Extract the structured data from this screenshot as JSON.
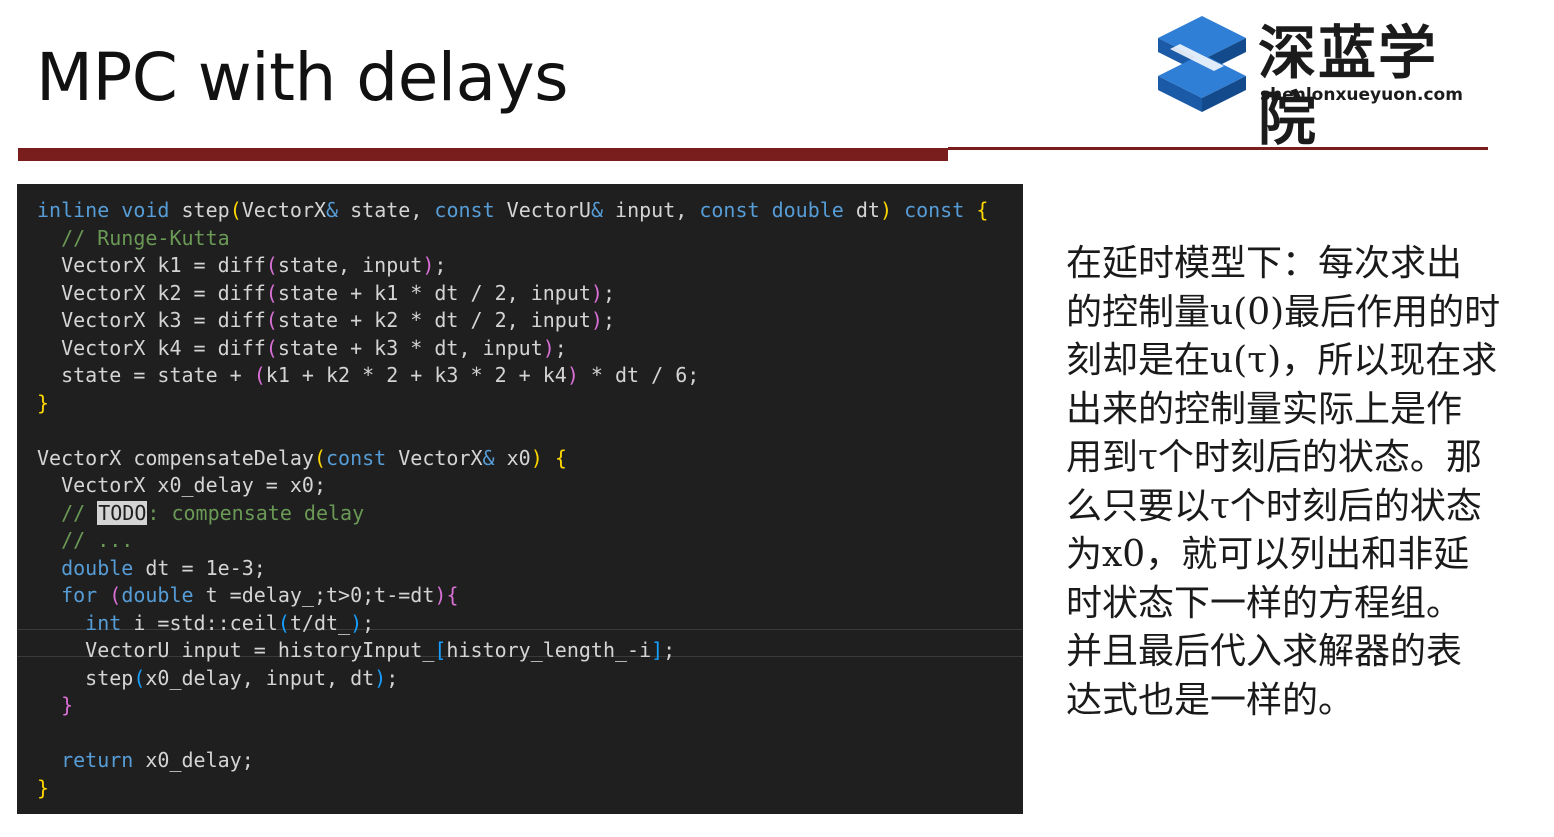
{
  "slide": {
    "title": "MPC with delays",
    "logo": {
      "name_cn": "深蓝学院",
      "url": "shenlonxueyuon.com",
      "color": "#1f6bc2"
    },
    "accent_color": "#7a1d1d"
  },
  "code_lines": [
    "inline void step(VectorX& state, const VectorU& input, const double dt) const {",
    "  // Runge-Kutta",
    "  VectorX k1 = diff(state, input);",
    "  VectorX k2 = diff(state + k1 * dt / 2, input);",
    "  VectorX k3 = diff(state + k2 * dt / 2, input);",
    "  VectorX k4 = diff(state + k3 * dt, input);",
    "  state = state + (k1 + k2 * 2 + k3 * 2 + k4) * dt / 6;",
    "}",
    "",
    "VectorX compensateDelay(const VectorX& x0) {",
    "  VectorX x0_delay = x0;",
    "  // TODO: compensate delay",
    "  // ...",
    "  double dt = 1e-3;",
    "  for (double t =delay_;t>0;t-=dt){",
    "    int i =std::ceil(t/dt_);",
    "    VectorU input = historyInput_[history_length_-i];",
    "    step(x0_delay, input, dt);",
    "  }",
    "",
    "  return x0_delay;",
    "}"
  ],
  "description_lines": [
    "在延时模型下：每次求出",
    "的控制量u(0)最后作用的时",
    "刻却是在u(τ)，所以现在求",
    "出来的控制量实际上是作",
    "用到τ个时刻后的状态。那",
    "么只要以τ个时刻后的状态",
    "为x0，就可以列出和非延",
    "时状态下一样的方程组。",
    "并且最后代入求解器的表",
    "达式也是一样的。"
  ]
}
